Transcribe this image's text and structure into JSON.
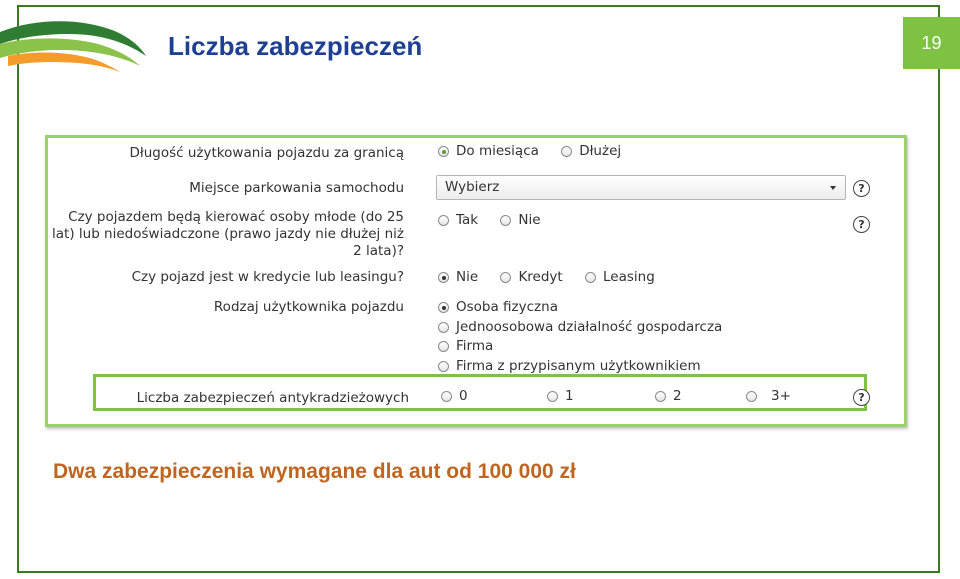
{
  "slide": {
    "title": "Liczba zabezpieczeń",
    "page_number": "19",
    "subtitle": "Dwa zabezpieczenia wymagane dla aut od 100 000 zł"
  },
  "colors": {
    "frame": "#3d7a1f",
    "title": "#1d3f94",
    "page_badge": "#7dc243",
    "highlight": "#7dc243",
    "subtitle": "#c0651f"
  },
  "form": {
    "usage_abroad": {
      "label": "Długość użytkowania pojazdu za granicą",
      "options": [
        "Do miesiąca",
        "Dłużej"
      ],
      "selected": "Do miesiąca"
    },
    "parking": {
      "label": "Miejsce parkowania samochodu",
      "value": "Wybierz",
      "help": "?"
    },
    "young_drivers": {
      "label": "Czy pojazdem będą kierować osoby młode (do 25 lat) lub niedoświadczone (prawo jazdy nie dłużej niż 2 lata)?",
      "options": [
        "Tak",
        "Nie"
      ],
      "selected": null,
      "help": "?"
    },
    "credit_leasing": {
      "label": "Czy pojazd jest w kredycie lub leasingu?",
      "options": [
        "Nie",
        "Kredyt",
        "Leasing"
      ],
      "selected": "Nie"
    },
    "user_type": {
      "label": "Rodzaj użytkownika pojazdu",
      "options": [
        "Osoba fizyczna",
        "Jednoosobowa działalność gospodarcza",
        "Firma",
        "Firma z przypisanym użytkownikiem"
      ],
      "selected": "Osoba fizyczna"
    },
    "security_count": {
      "label": "Liczba zabezpieczeń antykradzieżowych",
      "options": [
        "0",
        "1",
        "2",
        "3+"
      ],
      "selected": null,
      "help": "?"
    }
  }
}
